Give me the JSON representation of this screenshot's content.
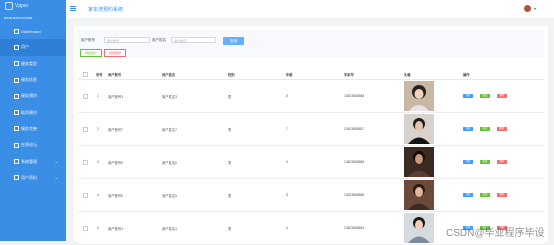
{
  "logo": "Vpper",
  "sidebar": {
    "heading": "MAIN NAVIGATION",
    "items": [
      {
        "label": "Dashboard",
        "icon": "home-icon"
      },
      {
        "label": "用户",
        "icon": "user-icon"
      },
      {
        "label": "服务类型",
        "icon": "grid-icon"
      },
      {
        "label": "服务信息",
        "icon": "grid-icon"
      },
      {
        "label": "服务预约",
        "icon": "grid-icon"
      },
      {
        "label": "取消预约",
        "icon": "grid-icon"
      },
      {
        "label": "服务完善",
        "icon": "grid-icon"
      },
      {
        "label": "在线论坛",
        "icon": "chat-icon"
      },
      {
        "label": "系统管理",
        "icon": "gear-icon"
      },
      {
        "label": "用户资料",
        "icon": "person-icon"
      }
    ]
  },
  "topbar": {
    "title": "家本洗预约系统"
  },
  "filters": {
    "account_label": "用户账号",
    "account_placeholder": "用户账号",
    "name_label": "用户姓名",
    "name_placeholder": "用户姓名",
    "query_button": "查询",
    "add_button": "添加用户",
    "delete_button": "批量删除"
  },
  "table": {
    "headers": [
      "序号",
      "用户账号",
      "用户姓名",
      "性别",
      "年龄",
      "手机号",
      "头像",
      "操作"
    ],
    "rows": [
      {
        "index": "1",
        "account": "用户账号3",
        "name": "用户姓名3",
        "gender": "男",
        "age": "8",
        "phone": "13823888888"
      },
      {
        "index": "2",
        "account": "用户账号7",
        "name": "用户姓名7",
        "gender": "男",
        "age": "7",
        "phone": "13823888887"
      },
      {
        "index": "3",
        "account": "用户账号6",
        "name": "用户姓名6",
        "gender": "男",
        "age": "6",
        "phone": "13823888886"
      },
      {
        "index": "4",
        "account": "用户账号5",
        "name": "用户姓名5",
        "gender": "男",
        "age": "5",
        "phone": "13823888885"
      },
      {
        "index": "5",
        "account": "用户账号4",
        "name": "用户姓名4",
        "gender": "男",
        "age": "4",
        "phone": "13823888884"
      }
    ],
    "row_buttons": {
      "detail": "详情",
      "edit": "修改",
      "delete": "删除"
    }
  },
  "watermark": "CSDN@毕业程序毕设",
  "colors": {
    "sidebar": "#3a8ee6",
    "detail": "#409eff",
    "edit": "#67c23a",
    "delete": "#f56c6c"
  }
}
